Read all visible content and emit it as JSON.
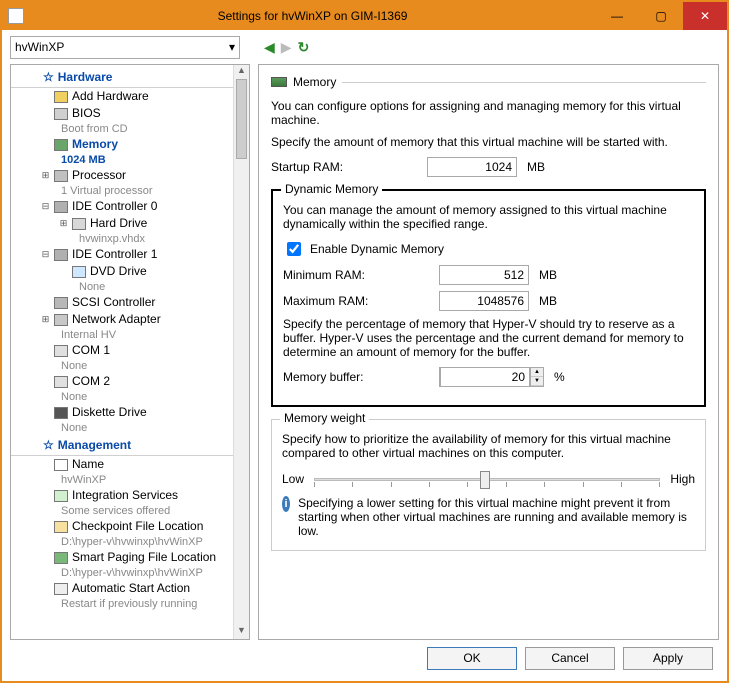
{
  "window": {
    "title": "Settings for hvWinXP on GIM-I1369"
  },
  "toolbar": {
    "vm_name": "hvWinXP"
  },
  "tree": {
    "hardware_header": "Hardware",
    "management_header": "Management",
    "items": {
      "add_hardware": "Add Hardware",
      "bios": "BIOS",
      "bios_sub": "Boot from CD",
      "memory": "Memory",
      "memory_sub": "1024 MB",
      "processor": "Processor",
      "processor_sub": "1 Virtual processor",
      "ide0": "IDE Controller 0",
      "hard_drive": "Hard Drive",
      "hard_drive_sub": "hvwinxp.vhdx",
      "ide1": "IDE Controller 1",
      "dvd": "DVD Drive",
      "dvd_sub": "None",
      "scsi": "SCSI Controller",
      "net": "Network Adapter",
      "net_sub": "Internal HV",
      "com1": "COM 1",
      "com1_sub": "None",
      "com2": "COM 2",
      "com2_sub": "None",
      "diskette": "Diskette Drive",
      "diskette_sub": "None",
      "name": "Name",
      "name_sub": "hvWinXP",
      "integration": "Integration Services",
      "integration_sub": "Some services offered",
      "checkpoint": "Checkpoint File Location",
      "checkpoint_sub": "D:\\hyper-v\\hvwinxp\\hvWinXP",
      "smart": "Smart Paging File Location",
      "smart_sub": "D:\\hyper-v\\hvwinxp\\hvWinXP",
      "auto": "Automatic Start Action",
      "auto_sub": "Restart if previously running"
    }
  },
  "memory": {
    "heading": "Memory",
    "intro": "You can configure options for assigning and managing memory for this virtual machine.",
    "specify": "Specify the amount of memory that this virtual machine will be started with.",
    "startup_label": "Startup RAM:",
    "startup_value": "1024",
    "mb": "MB",
    "dynamic": {
      "title": "Dynamic Memory",
      "desc": "You can manage the amount of memory assigned to this virtual machine dynamically within the specified range.",
      "enable_label": "Enable Dynamic Memory",
      "min_label": "Minimum RAM:",
      "min_value": "512",
      "max_label": "Maximum RAM:",
      "max_value": "1048576",
      "buffer_desc": "Specify the percentage of memory that Hyper-V should try to reserve as a buffer. Hyper-V uses the percentage and the current demand for memory to determine an amount of memory for the buffer.",
      "buffer_label": "Memory buffer:",
      "buffer_value": "20",
      "percent": "%"
    },
    "weight": {
      "title": "Memory weight",
      "desc": "Specify how to prioritize the availability of memory for this virtual machine compared to other virtual machines on this computer.",
      "low": "Low",
      "high": "High",
      "info": "Specifying a lower setting for this virtual machine might prevent it from starting when other virtual machines are running and available memory is low."
    }
  },
  "footer": {
    "ok": "OK",
    "cancel": "Cancel",
    "apply": "Apply"
  }
}
